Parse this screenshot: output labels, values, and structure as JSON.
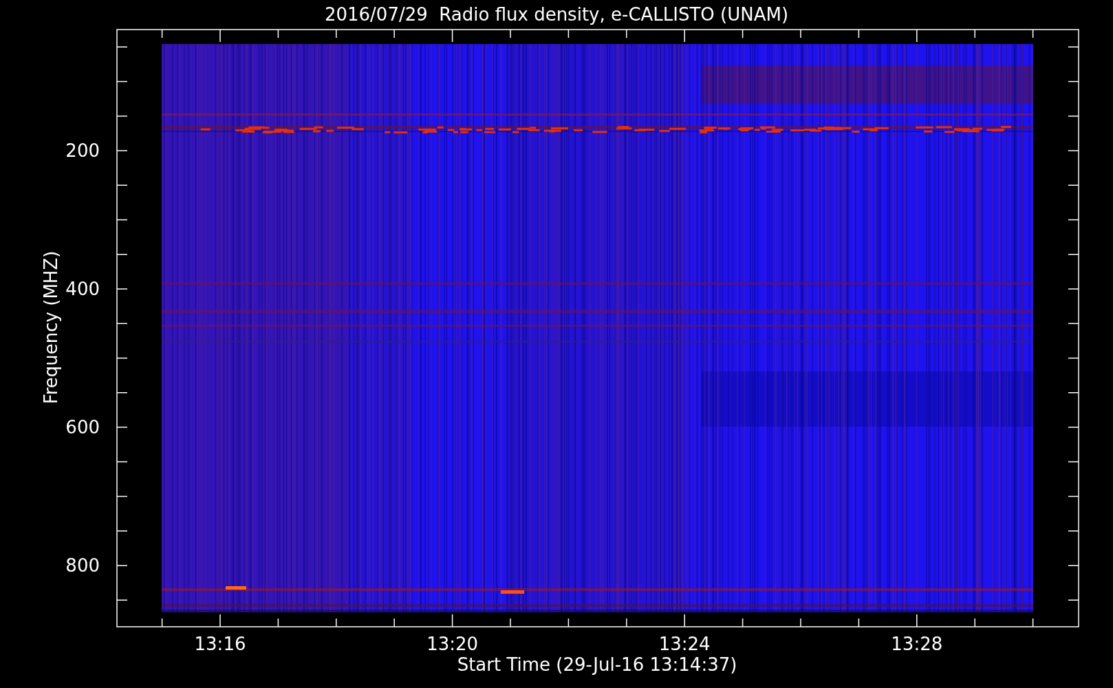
{
  "chart": {
    "title": "2016/07/29  Radio flux density, e-CALLISTO (UNAM)",
    "xlabel": "Start Time (29-Jul-16 13:14:37)",
    "ylabel": "Frequency (MHZ)",
    "xtick_labels": [
      "13:16",
      "13:20",
      "13:24",
      "13:28"
    ],
    "ytick_labels": [
      "200",
      "400",
      "600",
      "800"
    ]
  }
}
